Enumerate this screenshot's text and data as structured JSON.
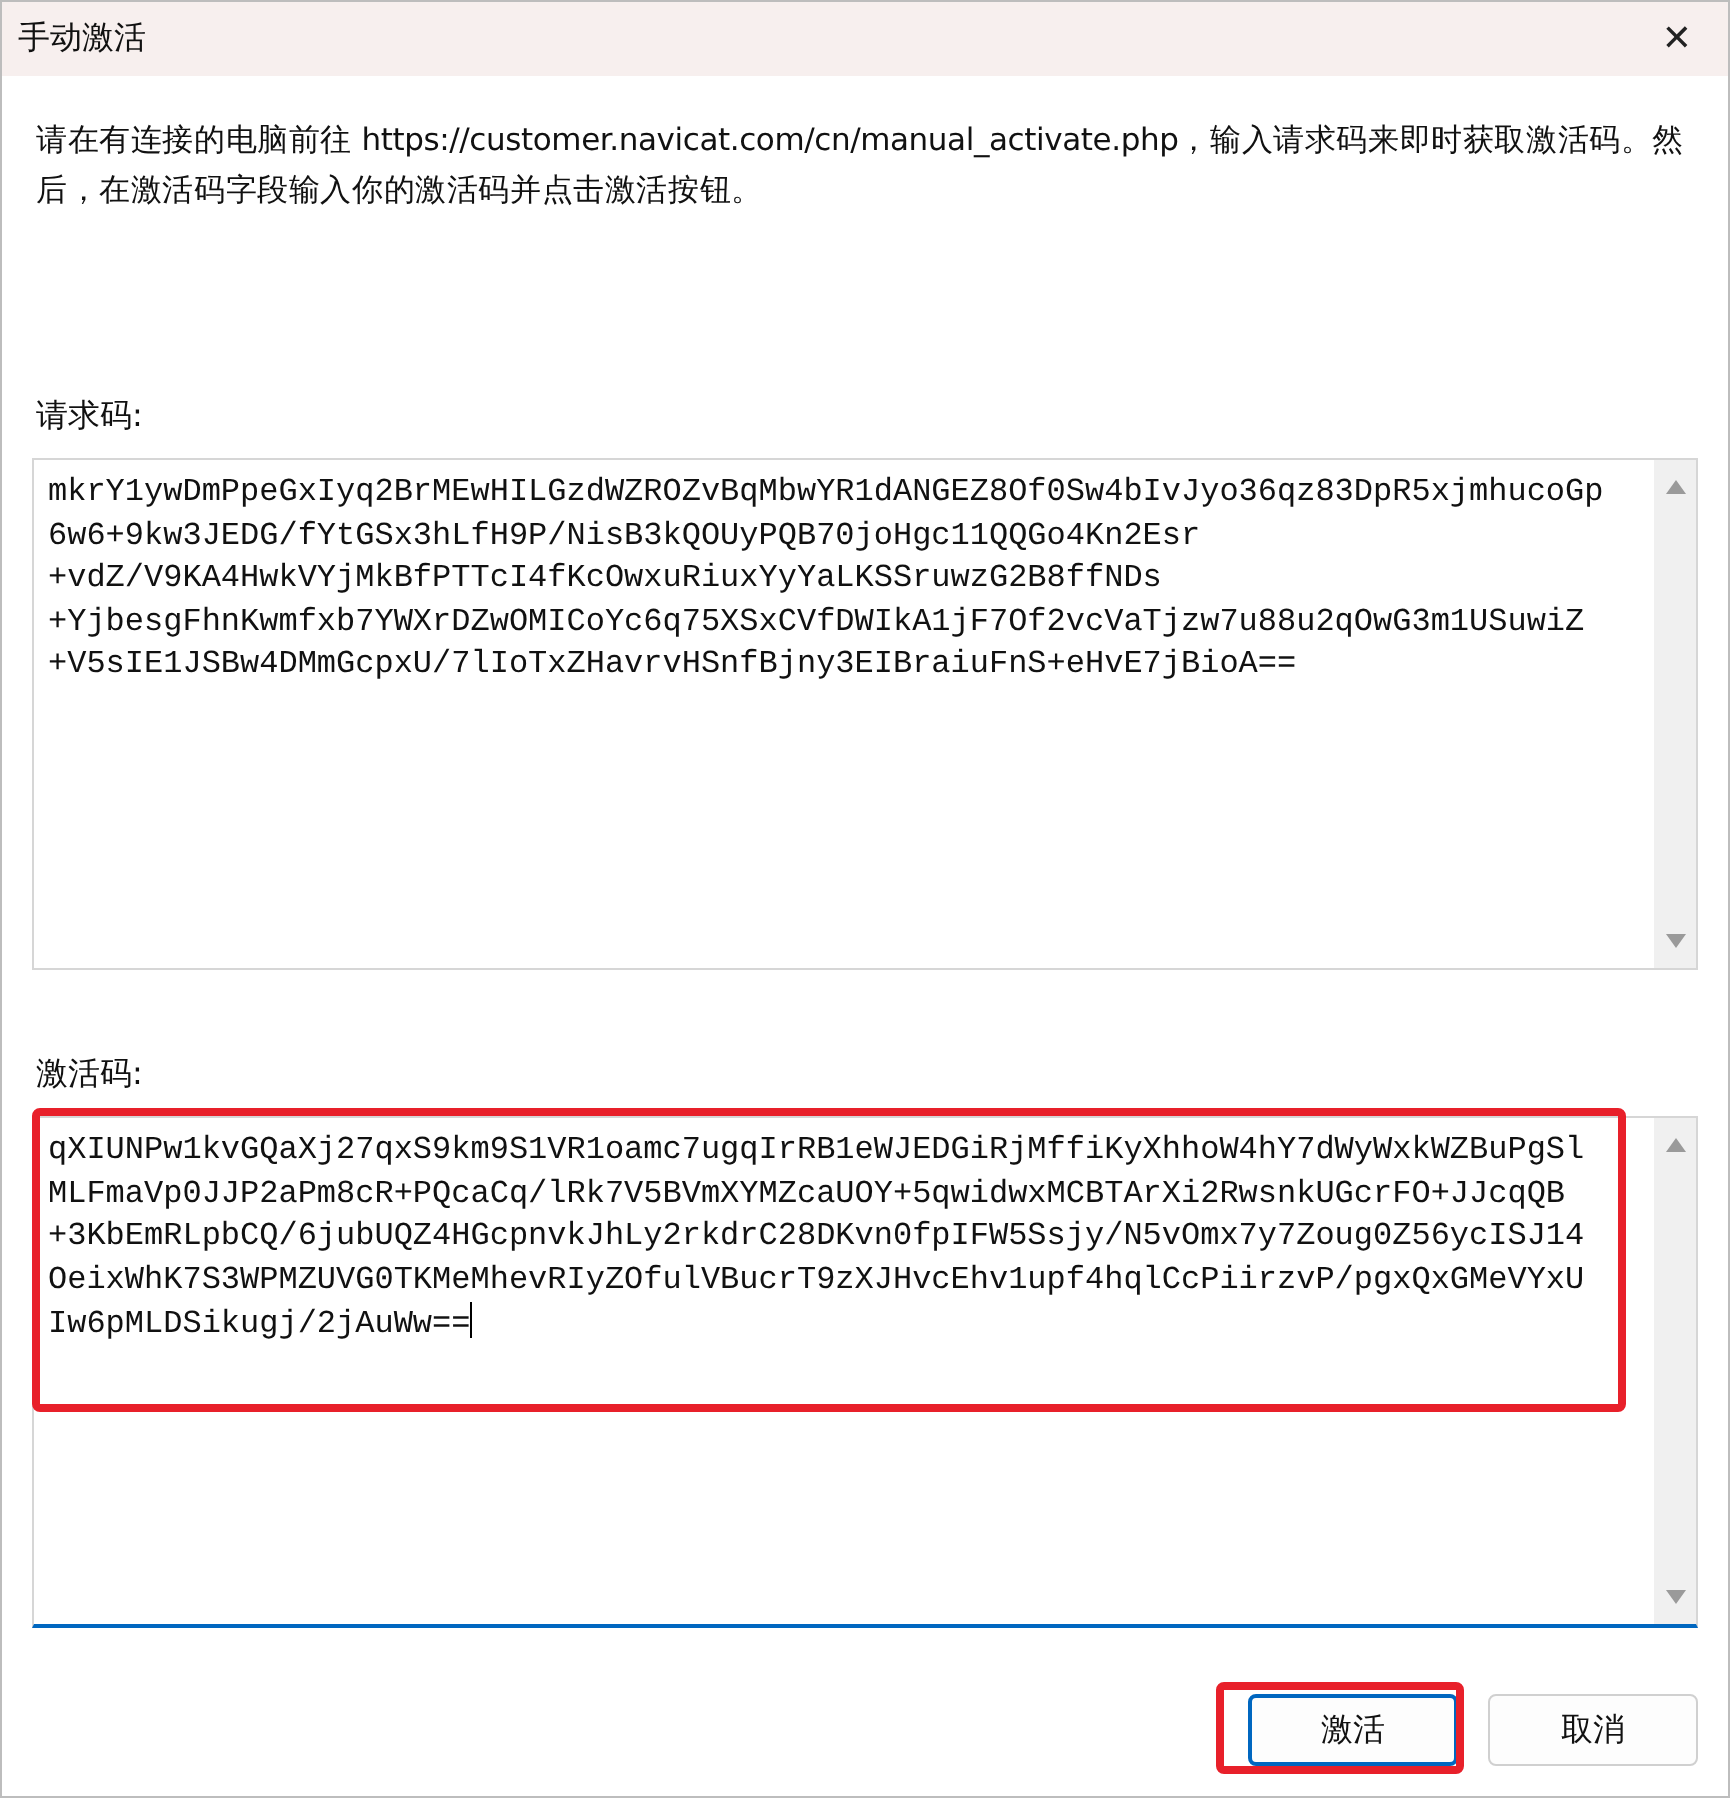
{
  "window": {
    "title": "手动激活",
    "close": "✕"
  },
  "instructions": "请在有连接的电脑前往 https://customer.navicat.com/cn/manual_activate.php，输入请求码来即时获取激活码。然后，在激活码字段输入你的激活码并点击激活按钮。",
  "fields": [
    {
      "label": "请求码:",
      "focused": false,
      "highlighted": false,
      "lines": [
        "mkrY1ywDmPpeGxIyq2BrMEwHILGzdWZROZvBqMbwYR1dANGEZ8Of0Sw4bIvJyo36qz83DpR5xjmhucoGp",
        "6w6+9kw3JEDG/fYtGSx3hLfH9P/NisB3kQOUyPQB70joHgc11QQGo4Kn2Esr",
        "+vdZ/V9KA4HwkVYjMkBfPTTcI4fKcOwxuRiuxYyYaLKSSruwzG2B8ffNDs",
        "+YjbesgFhnKwmfxb7YWXrDZwOMICoYc6q75XSxCVfDWIkA1jF7Of2vcVaTjzw7u88u2qOwG3m1USuwiZ",
        "+V5sIE1JSBw4DMmGcpxU/7lIoTxZHavrvHSnfBjny3EIBraiuFnS+eHvE7jBioA=="
      ]
    },
    {
      "label": "激活码:",
      "focused": true,
      "highlighted": true,
      "lines": [
        "qXIUNPw1kvGQaXj27qxS9km9S1VR1oamc7ugqIrRB1eWJEDGiRjMffiKyXhhoW4hY7dWyWxkWZBuPgSl",
        "MLFmaVp0JJP2aPm8cR+PQcaCq/lRk7V5BVmXYMZcaUOY+5qwidwxMCBTArXi2RwsnkUGcrFO+JJcqQB",
        "+3KbEmRLpbCQ/6jubUQZ4HGcpnvkJhLy2rkdrC28DKvn0fpIFW5Ssjy/N5vOmx7y7Zoug0Z56ycISJ14",
        "OeixWhK7S3WPMZUVG0TKMeMhevRIyZOfulVBucrT9zXJHvcEhv1upf4hqlCcPiirzvP/pgxQxGMeVYxU",
        "Iw6pMLDSikugj/2jAuWw=="
      ]
    }
  ],
  "buttons": [
    {
      "label": "激活",
      "default": true,
      "highlighted": true
    },
    {
      "label": "取消",
      "default": false,
      "highlighted": false
    }
  ]
}
